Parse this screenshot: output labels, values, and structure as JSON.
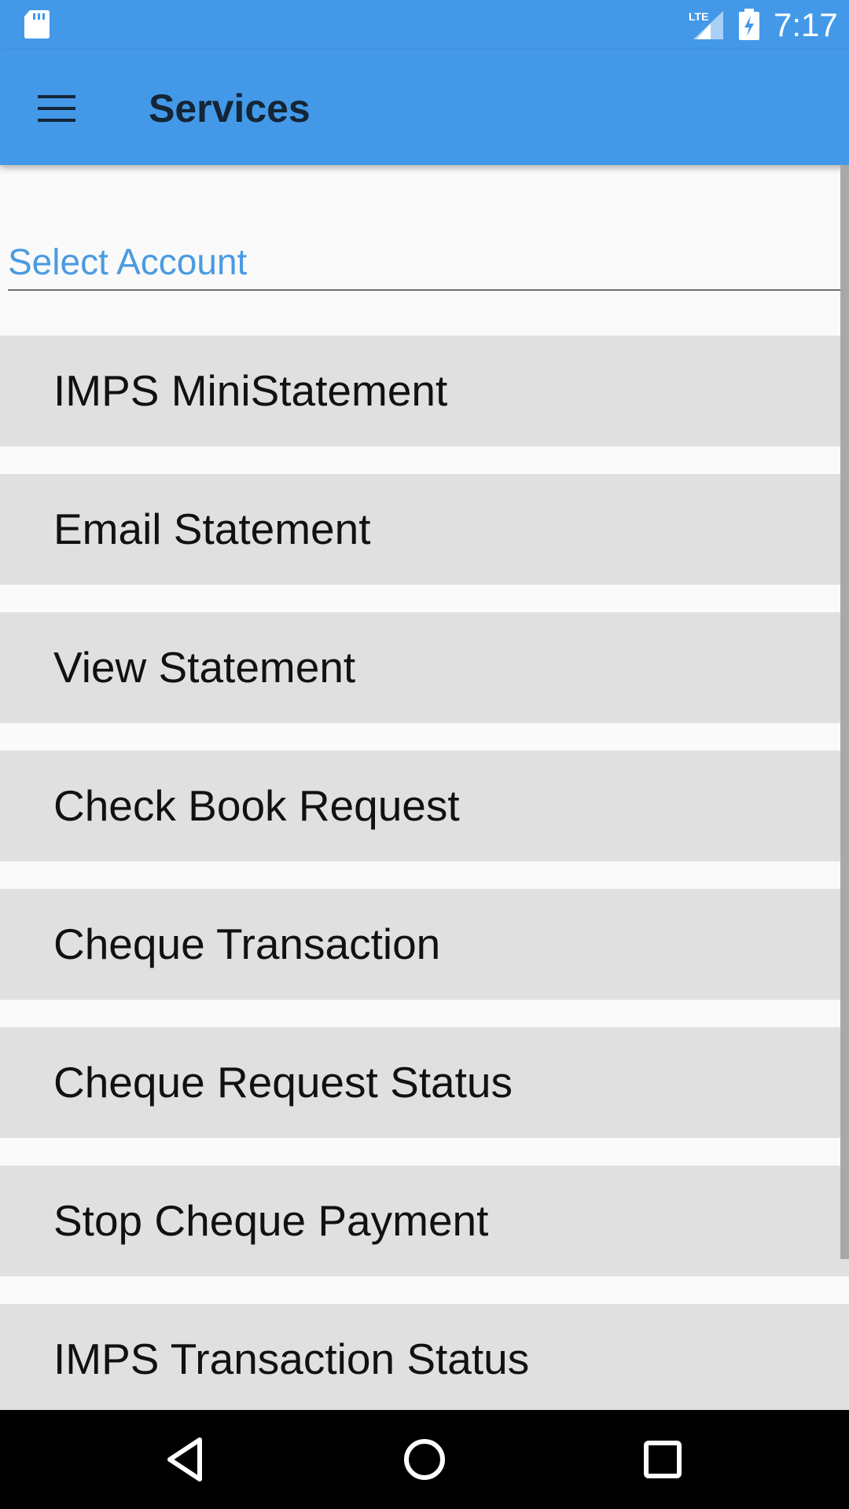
{
  "status_bar": {
    "time": "7:17",
    "network_label": "LTE",
    "icons": [
      "sd-card-icon",
      "lte-signal-icon",
      "battery-charging-icon"
    ]
  },
  "app_bar": {
    "title": "Services",
    "menu_icon": "hamburger-menu-icon"
  },
  "account": {
    "label": "Select Account"
  },
  "services": [
    {
      "label": "IMPS MiniStatement"
    },
    {
      "label": "Email Statement"
    },
    {
      "label": "View Statement"
    },
    {
      "label": "Check Book Request"
    },
    {
      "label": "Cheque Transaction"
    },
    {
      "label": "Cheque Request Status"
    },
    {
      "label": "Stop Cheque Payment"
    },
    {
      "label": "IMPS Transaction Status"
    }
  ],
  "nav_bar": {
    "icons": [
      "back-icon",
      "home-icon",
      "recents-icon"
    ]
  },
  "colors": {
    "app_bar": "#4399e8",
    "title_text": "#142536",
    "account_label": "#4a9be2",
    "list_item_bg": "#e0e0e0",
    "background": "#fafafa"
  }
}
